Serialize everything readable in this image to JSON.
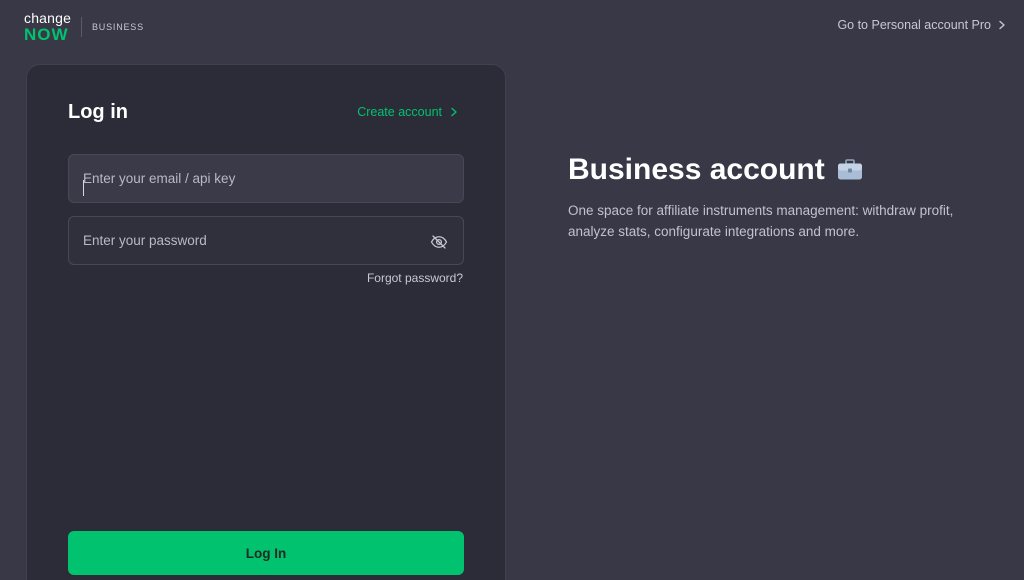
{
  "header": {
    "logo_line1": "change",
    "logo_line2": "NOW",
    "section_label": "BUSINESS",
    "personal_link": "Go to Personal account Pro"
  },
  "login": {
    "title": "Log in",
    "create_account": "Create account",
    "email_placeholder": "Enter your email / api key",
    "password_placeholder": "Enter your password",
    "forgot_password": "Forgot password?",
    "submit_label": "Log In"
  },
  "promo": {
    "title": "Business account",
    "description": "One space for affiliate instruments management: withdraw profit, analyze stats, configurate integrations and more."
  },
  "icons": {
    "chevron": "chevron-right-icon",
    "eye": "eye-off-icon",
    "briefcase": "briefcase-icon"
  },
  "colors": {
    "background": "#383846",
    "card": "#2c2c38",
    "accent": "#00c26f"
  }
}
